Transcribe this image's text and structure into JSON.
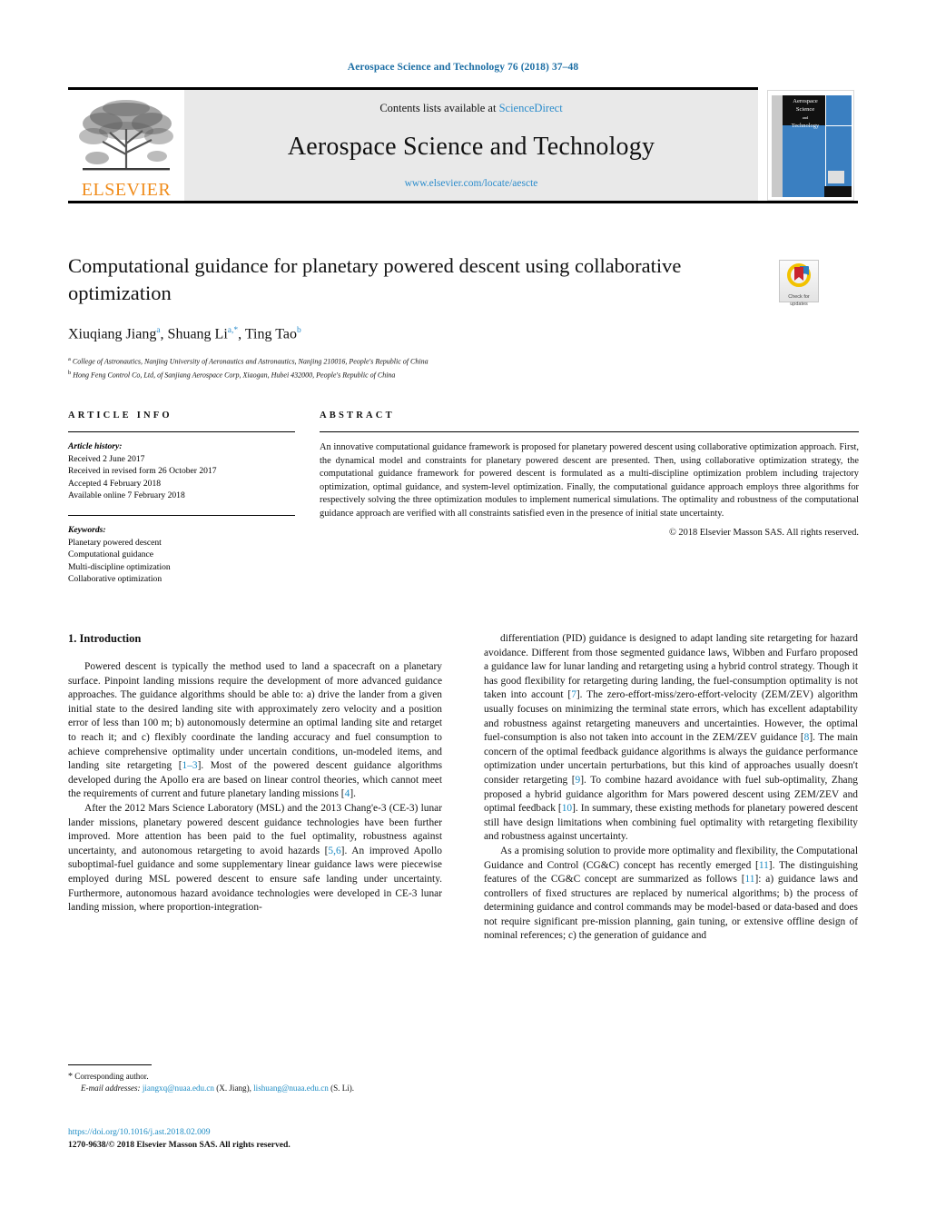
{
  "running_head": "Aerospace Science and Technology 76 (2018) 37–48",
  "masthead": {
    "contents_prefix": "Contents lists available at ",
    "sciencedirect": "ScienceDirect",
    "journal_title": "Aerospace Science and Technology",
    "journal_url": "www.elsevier.com/locate/aescte",
    "publisher_wordmark": "ELSEVIER",
    "cover": {
      "line1": "Aerospace",
      "line2": "Science",
      "line3": "and",
      "line4": "Technology"
    }
  },
  "article": {
    "title": "Computational guidance for planetary powered descent using collaborative optimization",
    "authors_html": "Xiuqiang Jiang<sup>a</sup>, Shuang Li<sup>a,*</sup>, Ting Tao<sup>b</sup>",
    "affiliation_a": "College of Astronautics, Nanjing University of Aeronautics and Astronautics, Nanjing 210016, People's Republic of China",
    "affiliation_b": "Hong Feng Control Co, Ltd, of Sanjiang Aerospace Corp, Xiaogan, Hubei 432000, People's Republic of China"
  },
  "crossmark": {
    "line1": "Check for",
    "line2": "updates"
  },
  "info": {
    "heading": "ARTICLE INFO",
    "history_label": "Article history:",
    "history": [
      "Received 2 June 2017",
      "Received in revised form 26 October 2017",
      "Accepted 4 February 2018",
      "Available online 7 February 2018"
    ],
    "keywords_label": "Keywords:",
    "keywords": [
      "Planetary powered descent",
      "Computational guidance",
      "Multi-discipline optimization",
      "Collaborative optimization"
    ]
  },
  "abstract": {
    "heading": "ABSTRACT",
    "text": "An innovative computational guidance framework is proposed for planetary powered descent using collaborative optimization approach. First, the dynamical model and constraints for planetary powered descent are presented. Then, using collaborative optimization strategy, the computational guidance framework for powered descent is formulated as a multi-discipline optimization problem including trajectory optimization, optimal guidance, and system-level optimization. Finally, the computational guidance approach employs three algorithms for respectively solving the three optimization modules to implement numerical simulations. The optimality and robustness of the computational guidance approach are verified with all constraints satisfied even in the presence of initial state uncertainty.",
    "copyright": "© 2018 Elsevier Masson SAS. All rights reserved."
  },
  "body": {
    "section_heading": "1. Introduction",
    "left_paragraphs": [
      "Powered descent is typically the method used to land a spacecraft on a planetary surface. Pinpoint landing missions require the development of more advanced guidance approaches. The guidance algorithms should be able to: a) drive the lander from a given initial state to the desired landing site with approximately zero velocity and a position error of less than 100 m; b) autonomously determine an optimal landing site and retarget to reach it; and c) flexibly coordinate the landing accuracy and fuel consumption to achieve comprehensive optimality under uncertain conditions, un-modeled items, and landing site retargeting [1–3]. Most of the powered descent guidance algorithms developed during the Apollo era are based on linear control theories, which cannot meet the requirements of current and future planetary landing missions [4].",
      "After the 2012 Mars Science Laboratory (MSL) and the 2013 Chang'e-3 (CE-3) lunar lander missions, planetary powered descent guidance technologies have been further improved. More attention has been paid to the fuel optimality, robustness against uncertainty, and autonomous retargeting to avoid hazards [5,6]. An improved Apollo suboptimal-fuel guidance and some supplementary linear guidance laws were piecewise employed during MSL powered descent to ensure safe landing under uncertainty. Furthermore, autonomous hazard avoidance technologies were developed in CE-3 lunar landing mission, where proportion-integration-"
    ],
    "right_paragraphs": [
      "differentiation (PID) guidance is designed to adapt landing site retargeting for hazard avoidance. Different from those segmented guidance laws, Wibben and Furfaro proposed a guidance law for lunar landing and retargeting using a hybrid control strategy. Though it has good flexibility for retargeting during landing, the fuel-consumption optimality is not taken into account [7]. The zero-effort-miss/zero-effort-velocity (ZEM/ZEV) algorithm usually focuses on minimizing the terminal state errors, which has excellent adaptability and robustness against retargeting maneuvers and uncertainties. However, the optimal fuel-consumption is also not taken into account in the ZEM/ZEV guidance [8]. The main concern of the optimal feedback guidance algorithms is always the guidance performance optimization under uncertain perturbations, but this kind of approaches usually doesn't consider retargeting [9]. To combine hazard avoidance with fuel sub-optimality, Zhang proposed a hybrid guidance algorithm for Mars powered descent using ZEM/ZEV and optimal feedback [10]. In summary, these existing methods for planetary powered descent still have design limitations when combining fuel optimality with retargeting flexibility and robustness against uncertainty.",
      "As a promising solution to provide more optimality and flexibility, the Computational Guidance and Control (CG&C) concept has recently emerged [11]. The distinguishing features of the CG&C concept are summarized as follows [11]: a) guidance laws and controllers of fixed structures are replaced by numerical algorithms; b) the process of determining guidance and control commands may be model-based or data-based and does not require significant pre-mission planning, gain tuning, or extensive offline design of nominal references; c) the generation of guidance and"
    ]
  },
  "footnote": {
    "star": "*",
    "corresponding": "Corresponding author.",
    "email_label": "E-mail addresses:",
    "email1": "jiangxq@nuaa.edu.cn",
    "email1_owner": "(X. Jiang),",
    "email2": "lishuang@nuaa.edu.cn",
    "email2_owner": "(S. Li)."
  },
  "imprint": {
    "doi": "https://doi.org/10.1016/j.ast.2018.02.009",
    "issn_line": "1270-9638/© 2018 Elsevier Masson SAS. All rights reserved."
  },
  "colors": {
    "link": "#1b8bc4",
    "accent_blue": "#2b8ccc",
    "elsevier_orange": "#f08c1b",
    "band_gray": "#e9e9e9",
    "cover_blue": "#3a7fc1"
  }
}
